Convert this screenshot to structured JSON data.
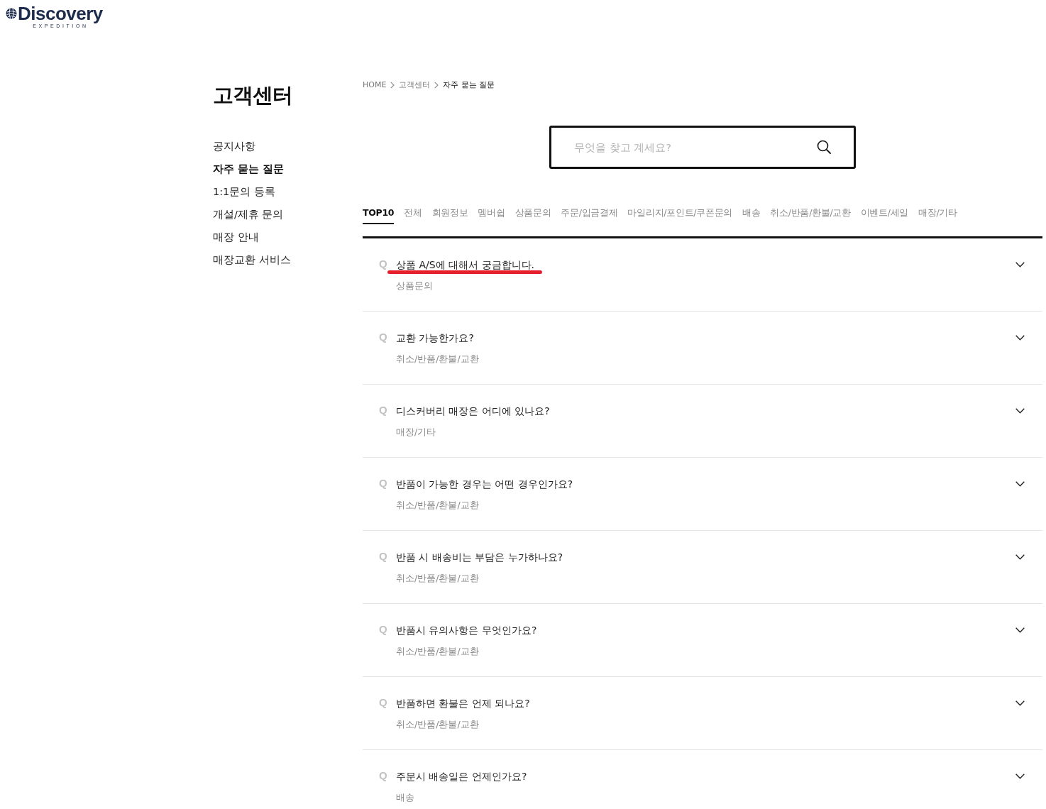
{
  "logo": {
    "wordmark": "Discovery",
    "subtitle": "EXPEDITION"
  },
  "sidebar": {
    "title": "고객센터",
    "items": [
      {
        "label": "공지사항",
        "selected": false
      },
      {
        "label": "자주 묻는 질문",
        "selected": true
      },
      {
        "label": "1:1문의 등록",
        "selected": false
      },
      {
        "label": "개설/제휴 문의",
        "selected": false
      },
      {
        "label": "매장 안내",
        "selected": false
      },
      {
        "label": "매장교환 서비스",
        "selected": false
      }
    ]
  },
  "breadcrumb": [
    {
      "label": "HOME",
      "current": false
    },
    {
      "label": "고객센터",
      "current": false
    },
    {
      "label": "자주 묻는 질문",
      "current": true
    }
  ],
  "search": {
    "placeholder": "무엇을 찾고 계세요?"
  },
  "tabs": [
    {
      "label": "TOP10",
      "selected": true
    },
    {
      "label": "전체",
      "selected": false
    },
    {
      "label": "회원정보",
      "selected": false
    },
    {
      "label": "멤버쉽",
      "selected": false
    },
    {
      "label": "상품문의",
      "selected": false
    },
    {
      "label": "주문/입금결제",
      "selected": false
    },
    {
      "label": "마일리지/포인트/쿠폰문의",
      "selected": false
    },
    {
      "label": "배송",
      "selected": false
    },
    {
      "label": "취소/반품/환불/교환",
      "selected": false
    },
    {
      "label": "이벤트/세일",
      "selected": false
    },
    {
      "label": "매장/기타",
      "selected": false
    }
  ],
  "faq": [
    {
      "marker": "Q",
      "question": "상품 A/S에 대해서 궁금합니다.",
      "category": "상품문의",
      "annotated": true
    },
    {
      "marker": "Q",
      "question": "교환 가능한가요?",
      "category": "취소/반품/환불/교환",
      "annotated": false
    },
    {
      "marker": "Q",
      "question": "디스커버리 매장은 어디에 있나요?",
      "category": "매장/기타",
      "annotated": false
    },
    {
      "marker": "Q",
      "question": "반품이 가능한 경우는 어떤 경우인가요?",
      "category": "취소/반품/환불/교환",
      "annotated": false
    },
    {
      "marker": "Q",
      "question": "반품 시 배송비는 부담은 누가하나요?",
      "category": "취소/반품/환불/교환",
      "annotated": false
    },
    {
      "marker": "Q",
      "question": "반품시 유의사항은 무엇인가요?",
      "category": "취소/반품/환불/교환",
      "annotated": false
    },
    {
      "marker": "Q",
      "question": "반품하면 환불은 언제 되나요?",
      "category": "취소/반품/환불/교환",
      "annotated": false
    },
    {
      "marker": "Q",
      "question": "주문시 배송일은 언제인가요?",
      "category": "배송",
      "annotated": false
    }
  ]
}
